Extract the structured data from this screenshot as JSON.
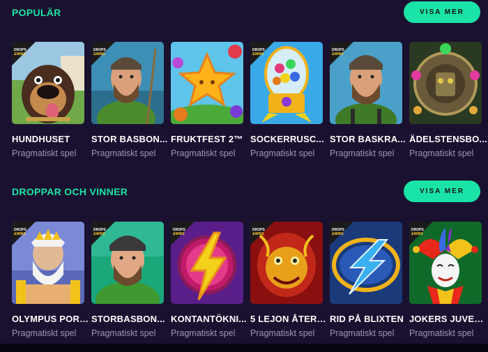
{
  "sections": [
    {
      "title": "POPULÄR",
      "button": "VISA MER",
      "games": [
        {
          "name": "HUNDHUSET",
          "provider": "Pragmatiskt spel",
          "badge": "DROPS & WINS"
        },
        {
          "name": "STOR BASBON...",
          "provider": "Pragmatiskt spel",
          "badge": "DROPS & WINS"
        },
        {
          "name": "FRUKTFEST 2™",
          "provider": "Pragmatiskt spel",
          "badge": ""
        },
        {
          "name": "SOCKERRUSC...",
          "provider": "Pragmatiskt spel",
          "badge": "DROPS & WINS"
        },
        {
          "name": "STOR BASKRA...",
          "provider": "Pragmatiskt spel",
          "badge": "DROPS & WINS"
        },
        {
          "name": "ÄDELSTENSBO...",
          "provider": "Pragmatiskt spel",
          "badge": ""
        }
      ]
    },
    {
      "title": "DROPPAR OCH VINNER",
      "button": "VISA MER",
      "games": [
        {
          "name": "OLYMPUS PORT...",
          "provider": "Pragmatiskt spel",
          "badge": "DROPS & WINS"
        },
        {
          "name": "STORBASBON...",
          "provider": "Pragmatiskt spel",
          "badge": "DROPS & WINS"
        },
        {
          "name": "KONTANTÖKNI...",
          "provider": "Pragmatiskt spel",
          "badge": "DROPS & WINS"
        },
        {
          "name": "5 LEJON ÅTERF...",
          "provider": "Pragmatiskt spel",
          "badge": "DROPS & WINS"
        },
        {
          "name": "RID PÅ BLIXTEN",
          "provider": "Pragmatiskt spel",
          "badge": "DROPS & WINS"
        },
        {
          "name": "JOKERS JUVEL...",
          "provider": "Pragmatiskt spel",
          "badge": "DROPS & WINS"
        }
      ]
    }
  ]
}
